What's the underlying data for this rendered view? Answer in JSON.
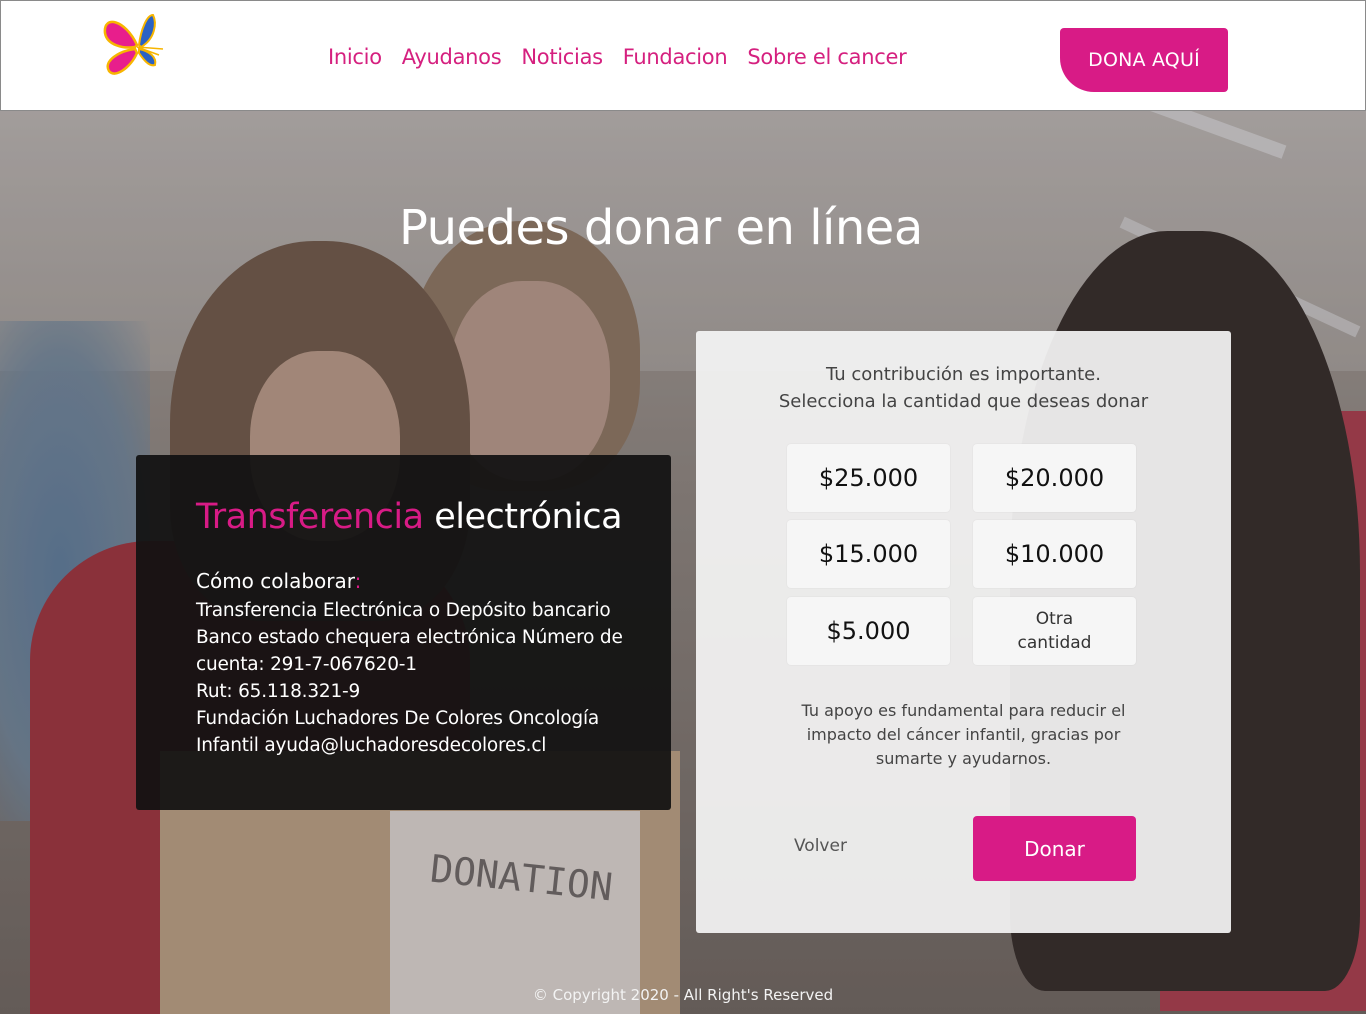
{
  "header": {
    "nav": [
      "Inicio",
      "Ayudanos",
      "Noticias",
      "Fundacion",
      "Sobre el cancer"
    ],
    "cta": "DONA AQUÍ"
  },
  "hero": {
    "headline": "Puedes donar en línea",
    "background_text": "DONATION"
  },
  "transfer": {
    "title_highlight": "Transferencia",
    "title_rest": " electrónica",
    "how_label": "Cómo colaborar",
    "how_colon": ":",
    "lines": [
      "Transferencia Electrónica o Depósito bancario",
      "Banco estado chequera electrónica Número de",
      "cuenta: 291-7-067620-1",
      "Rut: 65.118.321-9",
      "Fundación Luchadores De Colores Oncología",
      "Infantil ayuda@luchadoresdecolores.cl"
    ]
  },
  "donation": {
    "intro_line1": "Tu contribución es importante.",
    "intro_line2": "Selecciona la cantidad que deseas donar",
    "amounts": [
      "$25.000",
      "$20.000",
      "$15.000",
      "$10.000",
      "$5.000"
    ],
    "other_line1": "Otra",
    "other_line2": "cantidad",
    "note_line1": "Tu apoyo es fundamental para reducir el",
    "note_line2": "impacto del cáncer infantil, gracias por",
    "note_line3": "sumarte y ayudarnos.",
    "back_label": "Volver",
    "donate_label": "Donar"
  },
  "footer": {
    "copyright": "© Copyright 2020 - All Right's Reserved"
  },
  "colors": {
    "brand_pink": "#d81b86",
    "panel_dark": "#111111",
    "card_light": "#f5f5f5"
  },
  "icons": {
    "logo": "butterfly-logo-icon"
  }
}
